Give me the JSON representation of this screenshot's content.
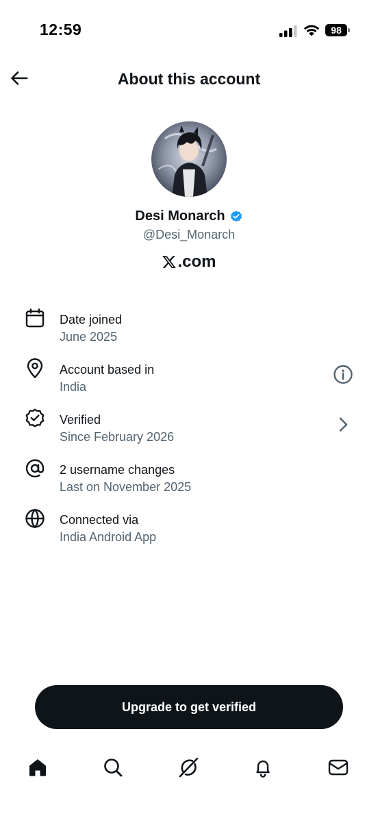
{
  "status_bar": {
    "time": "12:59",
    "battery": "98",
    "icons": [
      "signal-icon",
      "wifi-icon",
      "battery-icon"
    ]
  },
  "header": {
    "title": "About this account",
    "back_icon": "back-arrow-icon"
  },
  "profile": {
    "display_name": "Desi Monarch",
    "handle": "@Desi_Monarch",
    "verified": true,
    "domain_text": ".com",
    "domain_icon": "x-logo-icon"
  },
  "info_items": [
    {
      "icon": "calendar-icon",
      "label": "Date joined",
      "value": "June 2025",
      "trailing": ""
    },
    {
      "icon": "location-pin-icon",
      "label": "Account based in",
      "value": "India",
      "trailing": "info-icon"
    },
    {
      "icon": "verified-check-icon",
      "label": "Verified",
      "value": "Since February 2026",
      "trailing": "chevron-right-icon"
    },
    {
      "icon": "at-sign-icon",
      "label": "2 username changes",
      "value": "Last on November 2025",
      "trailing": ""
    },
    {
      "icon": "globe-icon",
      "label": "Connected via",
      "value": "India Android App",
      "trailing": ""
    }
  ],
  "upgrade_button": {
    "label": "Upgrade to get verified"
  },
  "bottom_nav": [
    {
      "icon": "home-icon",
      "active": true
    },
    {
      "icon": "search-icon",
      "active": false
    },
    {
      "icon": "grok-icon",
      "active": false
    },
    {
      "icon": "bell-icon",
      "active": false
    },
    {
      "icon": "mail-icon",
      "active": false
    }
  ],
  "colors": {
    "text_primary": "#0f1419",
    "text_secondary": "#536471",
    "verified_blue": "#1d9bf0",
    "button_bg": "#0f1419"
  }
}
